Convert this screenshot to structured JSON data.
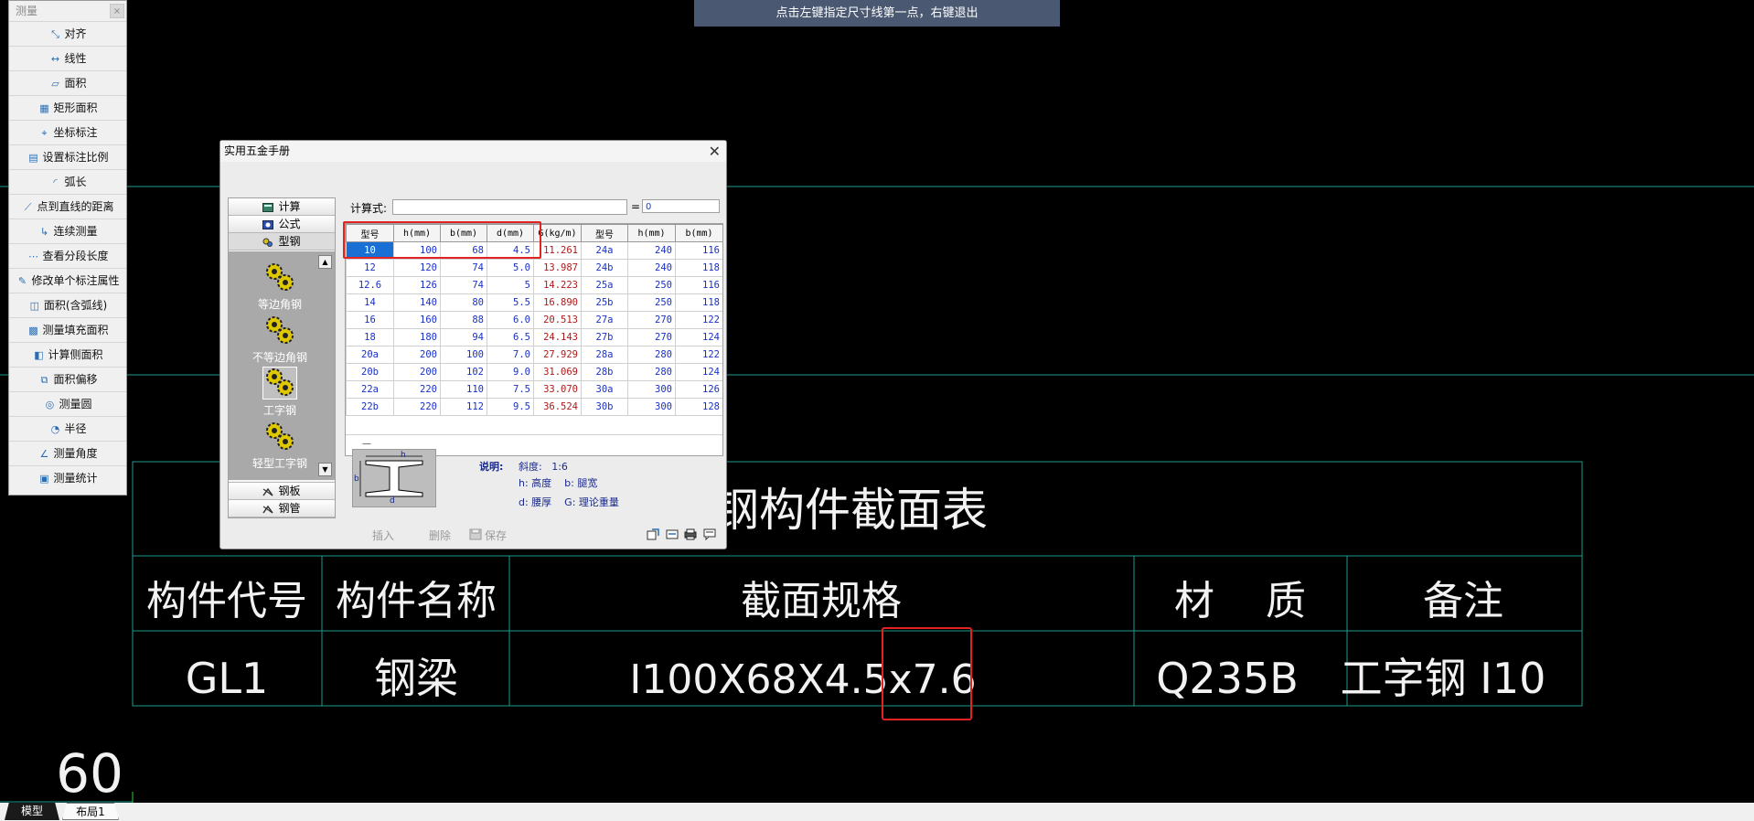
{
  "command_hint": "点击左键指定尺寸线第一点，右键退出",
  "measure_panel": {
    "title": "测量",
    "close": "×",
    "items": [
      {
        "label": "对齐",
        "icon": "aligned-dimension-icon",
        "glyph": "⤡"
      },
      {
        "label": "线性",
        "icon": "linear-dimension-icon",
        "glyph": "↔"
      },
      {
        "label": "面积",
        "icon": "area-icon",
        "glyph": "▱"
      },
      {
        "label": "矩形面积",
        "icon": "rectangle-area-icon",
        "glyph": "▦"
      },
      {
        "label": "坐标标注",
        "icon": "coordinate-icon",
        "glyph": "⌖"
      },
      {
        "label": "设置标注比例",
        "icon": "scale-setting-icon",
        "glyph": "▤"
      },
      {
        "label": "弧长",
        "icon": "arc-length-icon",
        "glyph": "◜"
      },
      {
        "label": "点到直线的距离",
        "icon": "point-line-distance-icon",
        "glyph": "⟋"
      },
      {
        "label": "连续测量",
        "icon": "continuous-measure-icon",
        "glyph": "↳"
      },
      {
        "label": "查看分段长度",
        "icon": "segment-length-icon",
        "glyph": "⋯"
      },
      {
        "label": "修改单个标注属性",
        "icon": "edit-dimension-icon",
        "glyph": "✎"
      },
      {
        "label": "面积(含弧线)",
        "icon": "arc-area-icon",
        "glyph": "◫"
      },
      {
        "label": "测量填充面积",
        "icon": "hatch-area-icon",
        "glyph": "▩"
      },
      {
        "label": "计算侧面积",
        "icon": "side-area-icon",
        "glyph": "◧"
      },
      {
        "label": "面积偏移",
        "icon": "area-offset-icon",
        "glyph": "⧉"
      },
      {
        "label": "测量圆",
        "icon": "circle-measure-icon",
        "glyph": "◎"
      },
      {
        "label": "半径",
        "icon": "radius-icon",
        "glyph": "◔"
      },
      {
        "label": "测量角度",
        "icon": "angle-icon",
        "glyph": "∠"
      },
      {
        "label": "测量统计",
        "icon": "statistics-icon",
        "glyph": "▣"
      }
    ]
  },
  "dialog": {
    "title": "实用五金手册",
    "close": "✕",
    "nav_top": [
      "计算",
      "公式",
      "型钢"
    ],
    "nav_bottom": [
      "钢板",
      "钢管"
    ],
    "steel_types": [
      "等边角钢",
      "不等边角钢",
      "工字钢",
      "轻型工字钢"
    ],
    "formula_label": "计算式:",
    "formula_value": "",
    "equals": "=",
    "result_value": "0",
    "table_headers": [
      "型号",
      "h(mm)",
      "b(mm)",
      "d(mm)",
      "G(kg/m)",
      "型号",
      "h(mm)",
      "b(mm)"
    ],
    "rows": [
      [
        "10",
        "100",
        "68",
        "4.5",
        "11.261",
        "24a",
        "240",
        "116"
      ],
      [
        "12",
        "120",
        "74",
        "5.0",
        "13.987",
        "24b",
        "240",
        "118"
      ],
      [
        "12.6",
        "126",
        "74",
        "5",
        "14.223",
        "25a",
        "250",
        "116"
      ],
      [
        "14",
        "140",
        "80",
        "5.5",
        "16.890",
        "25b",
        "250",
        "118"
      ],
      [
        "16",
        "160",
        "88",
        "6.0",
        "20.513",
        "27a",
        "270",
        "122"
      ],
      [
        "18",
        "180",
        "94",
        "6.5",
        "24.143",
        "27b",
        "270",
        "124"
      ],
      [
        "20a",
        "200",
        "100",
        "7.0",
        "27.929",
        "28a",
        "280",
        "122"
      ],
      [
        "20b",
        "200",
        "102",
        "9.0",
        "31.069",
        "28b",
        "280",
        "124"
      ],
      [
        "22a",
        "220",
        "110",
        "7.5",
        "33.070",
        "30a",
        "300",
        "126"
      ],
      [
        "22b",
        "220",
        "112",
        "9.5",
        "36.524",
        "30b",
        "300",
        "128"
      ]
    ],
    "footer_mark": "—",
    "diagram_labels": {
      "h": "h",
      "b": "b",
      "d": "d"
    },
    "desc_head": "说明:",
    "desc_lines": [
      "斜度:   1:6",
      "h: 高度    b: 腿宽",
      "d: 腰厚    G: 理论重量"
    ],
    "actions": [
      "插入",
      "删除",
      "保存"
    ]
  },
  "cad_table": {
    "title": "钢构件截面表",
    "headers": [
      "构件代号",
      "构件名称",
      "截面规格",
      "材    质",
      "备注"
    ],
    "row": [
      "GL1",
      "钢梁",
      "I100X68X4.5x7.6",
      "Q235B",
      "工字钢 I10"
    ]
  },
  "cad_number": "60",
  "tabs": [
    "模型",
    "布局1"
  ],
  "colors": {
    "cad_line": "#1e9a8e",
    "highlight": "#e32222",
    "hint_bg": "#4a5872"
  }
}
